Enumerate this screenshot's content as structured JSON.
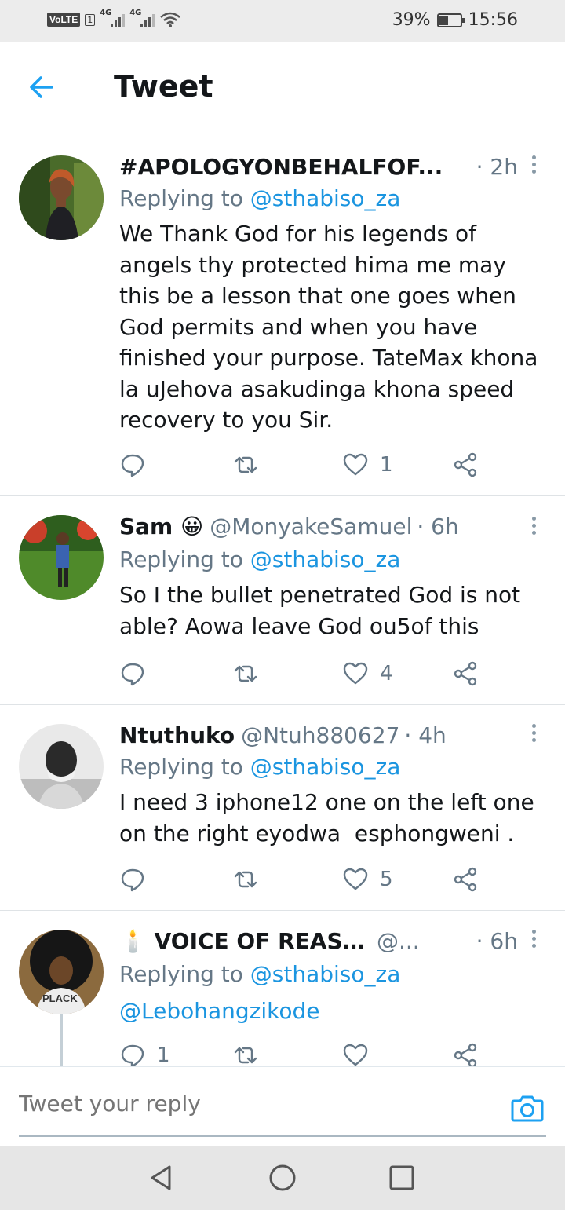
{
  "status_bar": {
    "volte": "VoLTE",
    "sim": "1",
    "net1": "4G",
    "net2": "4G",
    "battery": "39%",
    "battery_level": 0.39,
    "time": "15:56"
  },
  "header": {
    "title": "Tweet"
  },
  "colors": {
    "accent": "#1b95e0",
    "muted": "#657786",
    "text": "#14171a"
  },
  "tweets": [
    {
      "name": "#APOLOGYONBEHALFOF...",
      "handle": "",
      "time": "· 2h",
      "replying_label": "Replying to ",
      "replying_to": "@sthabiso_za",
      "body": "We Thank God for his legends of angels thy protected hima me may this be a lesson that one goes when God permits and when you have finished your purpose. TateMax khona la uJehova asakudinga khona speed recovery to you Sir.",
      "reply_count": "",
      "retweet_count": "",
      "like_count": "1"
    },
    {
      "name": "Sam 😀",
      "handle": "@MonyakeSamuel",
      "time": "· 6h",
      "replying_label": "Replying to ",
      "replying_to": "@sthabiso_za",
      "body": "So I the bullet penetrated God is not able? Aowa leave God ou5of this",
      "reply_count": "",
      "retweet_count": "",
      "like_count": "4"
    },
    {
      "name": "Ntuthuko",
      "handle": "@Ntuh880627",
      "time": "· 4h",
      "replying_label": "Replying to ",
      "replying_to": "@sthabiso_za",
      "body": "I need 3 iphone12 one on the left one on the right eyodwa  esphongweni .",
      "reply_count": "",
      "retweet_count": "",
      "like_count": "5"
    },
    {
      "name": "🕯️ VOICE OF REASON 🕯️",
      "handle": "@...",
      "time": "· 6h",
      "replying_label": "Replying to ",
      "replying_to": "@sthabiso_za",
      "body": "@Lebohangzikode",
      "avatar_shirt_text": "PLACK",
      "reply_count": "1",
      "retweet_count": "",
      "like_count": ""
    }
  ],
  "reply_bar": {
    "placeholder": "Tweet your reply"
  },
  "icons": [
    "back-arrow-icon",
    "more-icon",
    "reply-icon",
    "retweet-icon",
    "like-icon",
    "share-icon",
    "camera-icon",
    "nav-back-icon",
    "nav-home-icon",
    "nav-recents-icon"
  ]
}
